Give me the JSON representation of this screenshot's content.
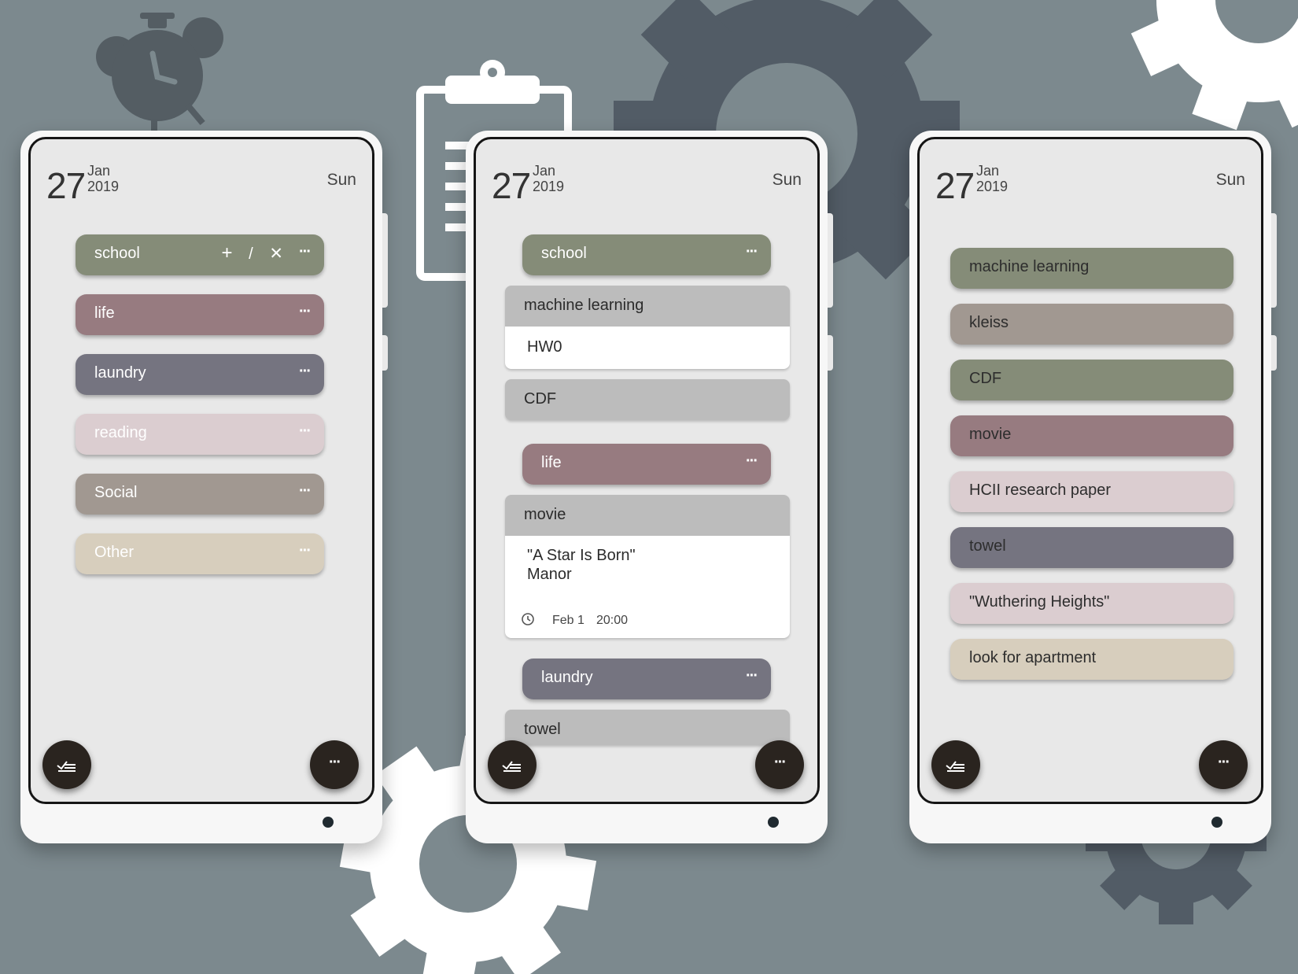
{
  "colors": {
    "background": "#7c898e",
    "olive": "#858c78",
    "mauve": "#977b80",
    "slate": "#757480",
    "pale_pink": "#dbcdd0",
    "taupe": "#a19891",
    "sand": "#d7cebd",
    "gray_header": "#bcbcbc",
    "fab": "#2a241f"
  },
  "date": {
    "day": "27",
    "month": "Jan",
    "year": "2019",
    "weekday": "Sun"
  },
  "icons": {
    "more": "more-horiz-icon",
    "checklist": "checklist-icon",
    "clock": "clock-icon",
    "add": "add-icon",
    "edit": "edit-icon",
    "delete": "close-icon"
  },
  "phone1": {
    "lists": [
      {
        "label": "school",
        "color": "olive",
        "text": "light",
        "more": "···",
        "add": "+",
        "edit": "/",
        "delete": "✕"
      },
      {
        "label": "life",
        "color": "mauve",
        "text": "light",
        "more": "···"
      },
      {
        "label": "laundry",
        "color": "slate",
        "text": "light",
        "more": "···"
      },
      {
        "label": "reading",
        "color": "pale_pink",
        "text": "light",
        "more": "···"
      },
      {
        "label": "Social",
        "color": "taupe",
        "text": "light",
        "more": "···"
      },
      {
        "label": "Other",
        "color": "sand",
        "text": "light",
        "more": "···"
      }
    ],
    "fab_left": "checklist-icon",
    "fab_right": "···"
  },
  "phone2": {
    "groups": [
      {
        "label": "school",
        "more": "···"
      },
      {
        "label": "life",
        "more": "···"
      },
      {
        "label": "laundry",
        "more": "···"
      }
    ],
    "notes": {
      "ml_title": "machine learning",
      "ml_body": "HW0",
      "cdf_title": "CDF",
      "movie_title": "movie",
      "movie_line1": "\"A Star Is Born\"",
      "movie_line2": "Manor",
      "movie_date": "Feb 1",
      "movie_time": "20:00",
      "towel_title": "towel"
    },
    "fab_right": "···"
  },
  "phone3": {
    "tasks": [
      {
        "label": "machine learning",
        "color": "olive"
      },
      {
        "label": "kleiss",
        "color": "taupe"
      },
      {
        "label": "CDF",
        "color": "olive"
      },
      {
        "label": "movie",
        "color": "mauve"
      },
      {
        "label": "HCII research paper",
        "color": "pale_pink"
      },
      {
        "label": "towel",
        "color": "slate"
      },
      {
        "label": "\"Wuthering Heights\"",
        "color": "pale_pink"
      },
      {
        "label": "look for apartment",
        "color": "sand"
      }
    ],
    "fab_right": "···"
  }
}
